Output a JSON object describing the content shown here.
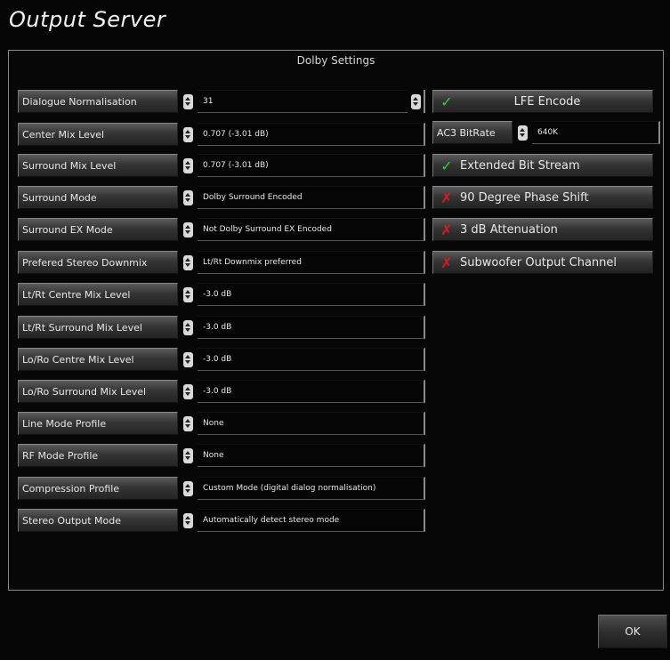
{
  "window": {
    "title": "Output Server"
  },
  "panel": {
    "title": "Dolby Settings"
  },
  "settings": [
    {
      "label": "Dialogue Normalisation",
      "value": "31"
    },
    {
      "label": "Center Mix Level",
      "value": "0.707 (-3.01 dB)"
    },
    {
      "label": "Surround Mix Level",
      "value": "0.707 (-3.01 dB)"
    },
    {
      "label": "Surround Mode",
      "value": "Dolby Surround Encoded"
    },
    {
      "label": "Surround EX Mode",
      "value": "Not Dolby Surround EX Encoded"
    },
    {
      "label": "Prefered Stereo Downmix",
      "value": "Lt/Rt Downmix preferred"
    },
    {
      "label": "Lt/Rt Centre Mix Level",
      "value": "-3.0 dB"
    },
    {
      "label": "Lt/Rt Surround Mix Level",
      "value": "-3.0 dB"
    },
    {
      "label": "Lo/Ro Centre Mix Level",
      "value": "-3.0 dB"
    },
    {
      "label": "Lo/Ro Surround Mix Level",
      "value": "-3.0 dB"
    },
    {
      "label": "Line Mode Profile",
      "value": "None"
    },
    {
      "label": "RF Mode Profile",
      "value": "None"
    },
    {
      "label": "Compression Profile",
      "value": "Custom Mode (digital dialog normalisation)"
    },
    {
      "label": "Stereo Output Mode",
      "value": "Automatically detect stereo mode"
    }
  ],
  "toggles": {
    "lfe": {
      "label": "LFE Encode",
      "checked": true,
      "mark": "✓"
    },
    "extended": {
      "label": "Extended Bit Stream",
      "checked": true,
      "mark": "✓"
    },
    "phase": {
      "label": "90 Degree Phase Shift",
      "checked": false,
      "mark": "✗"
    },
    "atten": {
      "label": "3 dB Attenuation",
      "checked": false,
      "mark": "✗"
    },
    "sub": {
      "label": "Subwoofer Output Channel",
      "checked": false,
      "mark": "✗"
    }
  },
  "ac3": {
    "label": "AC3 BitRate",
    "value": "640K"
  },
  "footer": {
    "ok_label": "OK"
  },
  "colors": {
    "check": "#2fd12f",
    "cross": "#e01818",
    "border": "#8a8a8a",
    "background": "#050505"
  }
}
